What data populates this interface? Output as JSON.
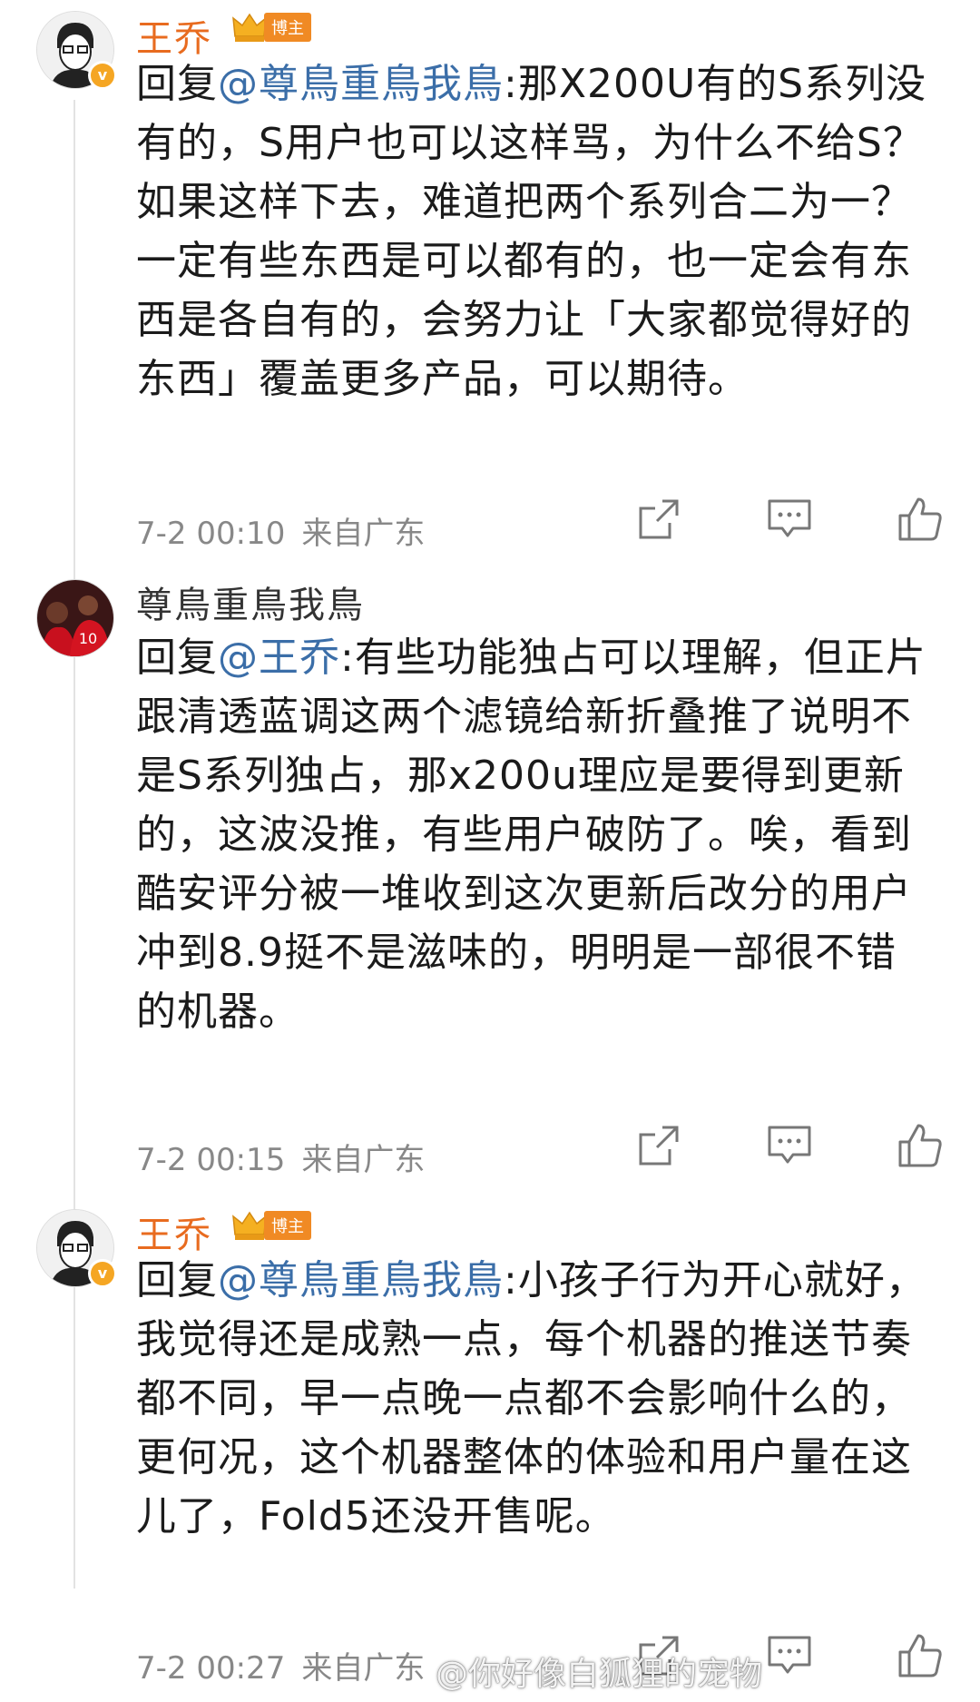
{
  "comments": [
    {
      "username": "王乔",
      "badge": "博主",
      "reply_prefix": "回复",
      "mention": "@尊鳥重鳥我鳥",
      "text": ":那X200U有的S系列没有的，S用户也可以这样骂，为什么不给S？如果这样下去，难道把两个系列合二为一？一定有些东西是可以都有的，也一定会有东西是各自有的，会努力让「大家都觉得好的东西」覆盖更多产品，可以期待。",
      "time": "7-2 00:10",
      "location": "来自广东"
    },
    {
      "username": "尊鳥重鳥我鳥",
      "reply_prefix": "回复",
      "mention": "@王乔",
      "text": ":有些功能独占可以理解，但正片跟清透蓝调这两个滤镜给新折叠推了说明不是S系列独占，那x200u理应是要得到更新的，这波没推，有些用户破防了。唉，看到酷安评分被一堆收到这次更新后改分的用户冲到8.9挺不是滋味的，明明是一部很不错的机器。",
      "time": "7-2 00:15",
      "location": "来自广东"
    },
    {
      "username": "王乔",
      "badge": "博主",
      "reply_prefix": "回复",
      "mention": "@尊鳥重鳥我鳥",
      "text": ":小孩子行为开心就好，我觉得还是成熟一点，每个机器的推送节奏都不同，早一点晚一点都不会影响什么的，更何况，这个机器整体的体验和用户量在这儿了，Fold5还没开售呢。",
      "time": "7-2 00:27",
      "location": "来自广东"
    }
  ],
  "watermark": "@你好像白狐狸的宠物",
  "colors": {
    "blogger_name": "#e86b1f",
    "mention": "#3b6ea8",
    "meta": "#888888"
  },
  "icons": [
    "share-icon",
    "comment-icon",
    "like-icon"
  ]
}
